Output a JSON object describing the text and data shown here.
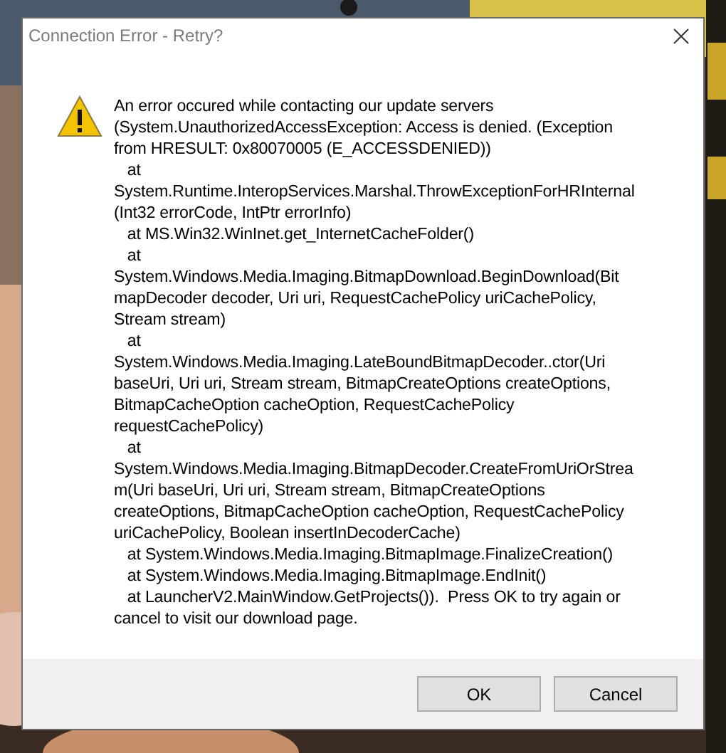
{
  "window": {
    "title": "Connection Error - Retry?"
  },
  "message": {
    "lines": [
      "An error occured while contacting our update servers",
      "(System.UnauthorizedAccessException: Access is denied. (Exception",
      "from HRESULT: 0x80070005 (E_ACCESSDENIED))",
      "   at",
      "System.Runtime.InteropServices.Marshal.ThrowExceptionForHRInternal",
      "(Int32 errorCode, IntPtr errorInfo)",
      "   at MS.Win32.WinInet.get_InternetCacheFolder()",
      "   at",
      "System.Windows.Media.Imaging.BitmapDownload.BeginDownload(Bit",
      "mapDecoder decoder, Uri uri, RequestCachePolicy uriCachePolicy,",
      "Stream stream)",
      "   at",
      "System.Windows.Media.Imaging.LateBoundBitmapDecoder..ctor(Uri",
      "baseUri, Uri uri, Stream stream, BitmapCreateOptions createOptions,",
      "BitmapCacheOption cacheOption, RequestCachePolicy",
      "requestCachePolicy)",
      "   at",
      "System.Windows.Media.Imaging.BitmapDecoder.CreateFromUriOrStrea",
      "m(Uri baseUri, Uri uri, Stream stream, BitmapCreateOptions",
      "createOptions, BitmapCacheOption cacheOption, RequestCachePolicy",
      "uriCachePolicy, Boolean insertInDecoderCache)",
      "   at System.Windows.Media.Imaging.BitmapImage.FinalizeCreation()",
      "   at System.Windows.Media.Imaging.BitmapImage.EndInit()",
      "   at LauncherV2.MainWindow.GetProjects()).  Press OK to try again or",
      "cancel to visit our download page."
    ]
  },
  "buttons": [
    {
      "label": "OK"
    },
    {
      "label": "Cancel"
    }
  ]
}
